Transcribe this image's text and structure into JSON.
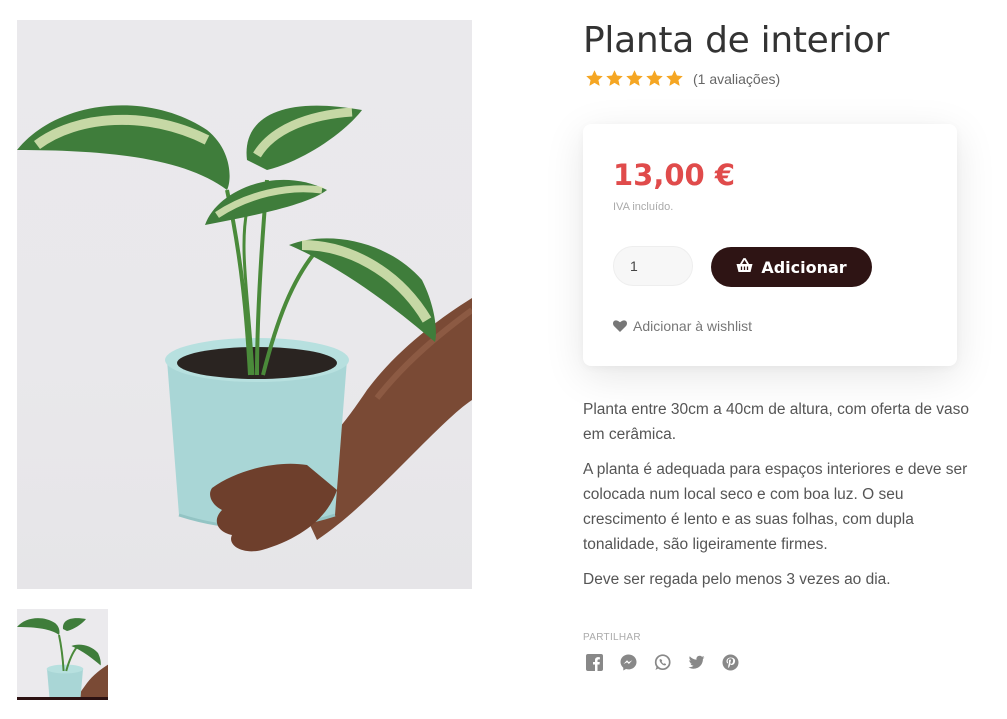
{
  "product": {
    "title": "Planta de interior",
    "rating": 5,
    "review_count_text": "(1 avaliações)",
    "price": "13,00 €",
    "vat_note": "IVA incluído.",
    "quantity": "1",
    "add_button_label": "Adicionar",
    "wishlist_label": "Adicionar à wishlist",
    "description": [
      "Planta entre 30cm a 40cm de altura, com oferta de vaso em cerâmica.",
      "A planta é adequada para espaços interiores e deve ser colocada num local seco e com boa luz. O seu crescimento é lento e as suas folhas, com dupla tonalidade, são ligeiramente firmes.",
      "Deve ser regada pelo menos 3 vezes ao dia."
    ]
  },
  "share": {
    "label": "PARTILHAR",
    "icons": [
      "facebook-icon",
      "messenger-icon",
      "whatsapp-icon",
      "twitter-icon",
      "pinterest-icon"
    ]
  },
  "colors": {
    "price": "#e04b4b",
    "button": "#2e1414",
    "star": "#f5a623"
  }
}
